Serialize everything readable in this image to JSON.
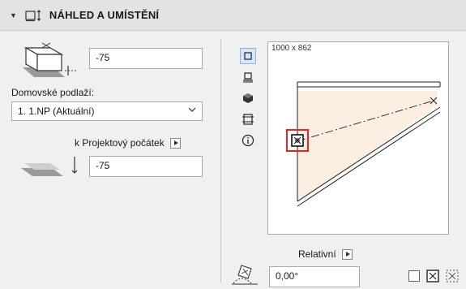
{
  "header": {
    "title": "NÁHLED A UMÍSTĚNÍ"
  },
  "left": {
    "top_offset_value": "-75",
    "home_story_label": "Domovské podlaží:",
    "home_story_selected": "1. 1.NP (Aktuální)",
    "reference_label": "k Projektový počátek",
    "bottom_offset_value": "-75"
  },
  "preview": {
    "size_label": "1000 x 862"
  },
  "bottom": {
    "relative_label": "Relativní",
    "angle_value": "0,00°"
  },
  "colors": {
    "fill": "#fdeee2",
    "highlight": "#e52521",
    "active_icon_bg": "#d6e6f7"
  }
}
